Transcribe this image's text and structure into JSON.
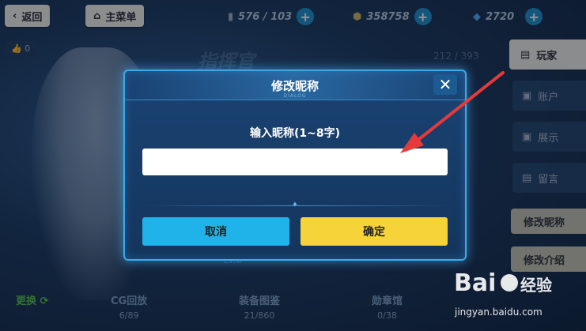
{
  "topbar": {
    "back_label": "返回",
    "main_menu_label": "主菜单",
    "resources": [
      {
        "icon": "stamina-icon",
        "value": "576 / 103"
      },
      {
        "icon": "coin-icon",
        "value": "358758"
      },
      {
        "icon": "crystal-icon",
        "value": "2720"
      }
    ],
    "plus_label": "+"
  },
  "background": {
    "likes": "0",
    "title": "指挥官",
    "exp": "212 / 393",
    "level": "Lv.0"
  },
  "sidebar": {
    "player_label": "玩家",
    "items": [
      {
        "label": "账户",
        "icon": "account-icon"
      },
      {
        "label": "展示",
        "icon": "display-icon"
      },
      {
        "label": "留言",
        "icon": "message-icon"
      }
    ],
    "rename_label": "修改昵称",
    "edit_intro_label": "修改介绍"
  },
  "bottom": {
    "swap_label": "更换",
    "stats": [
      {
        "label": "CG回放",
        "value": "6/89"
      },
      {
        "label": "装备图鉴",
        "value": "21/860"
      },
      {
        "label": "勋章馆",
        "value": "0/38"
      }
    ]
  },
  "dialog": {
    "title": "修改昵称",
    "subtitle": "DIALOG",
    "close_symbol": "✕",
    "prompt": "输入昵称(1~8字)",
    "input_value": "",
    "cancel_label": "取消",
    "confirm_label": "确定"
  },
  "watermark": {
    "text": "jingyan.baidu.com"
  },
  "colors": {
    "accent_blue": "#1fb3ea",
    "confirm_yellow": "#f7d33a",
    "annotation_red": "#e53a3a"
  }
}
